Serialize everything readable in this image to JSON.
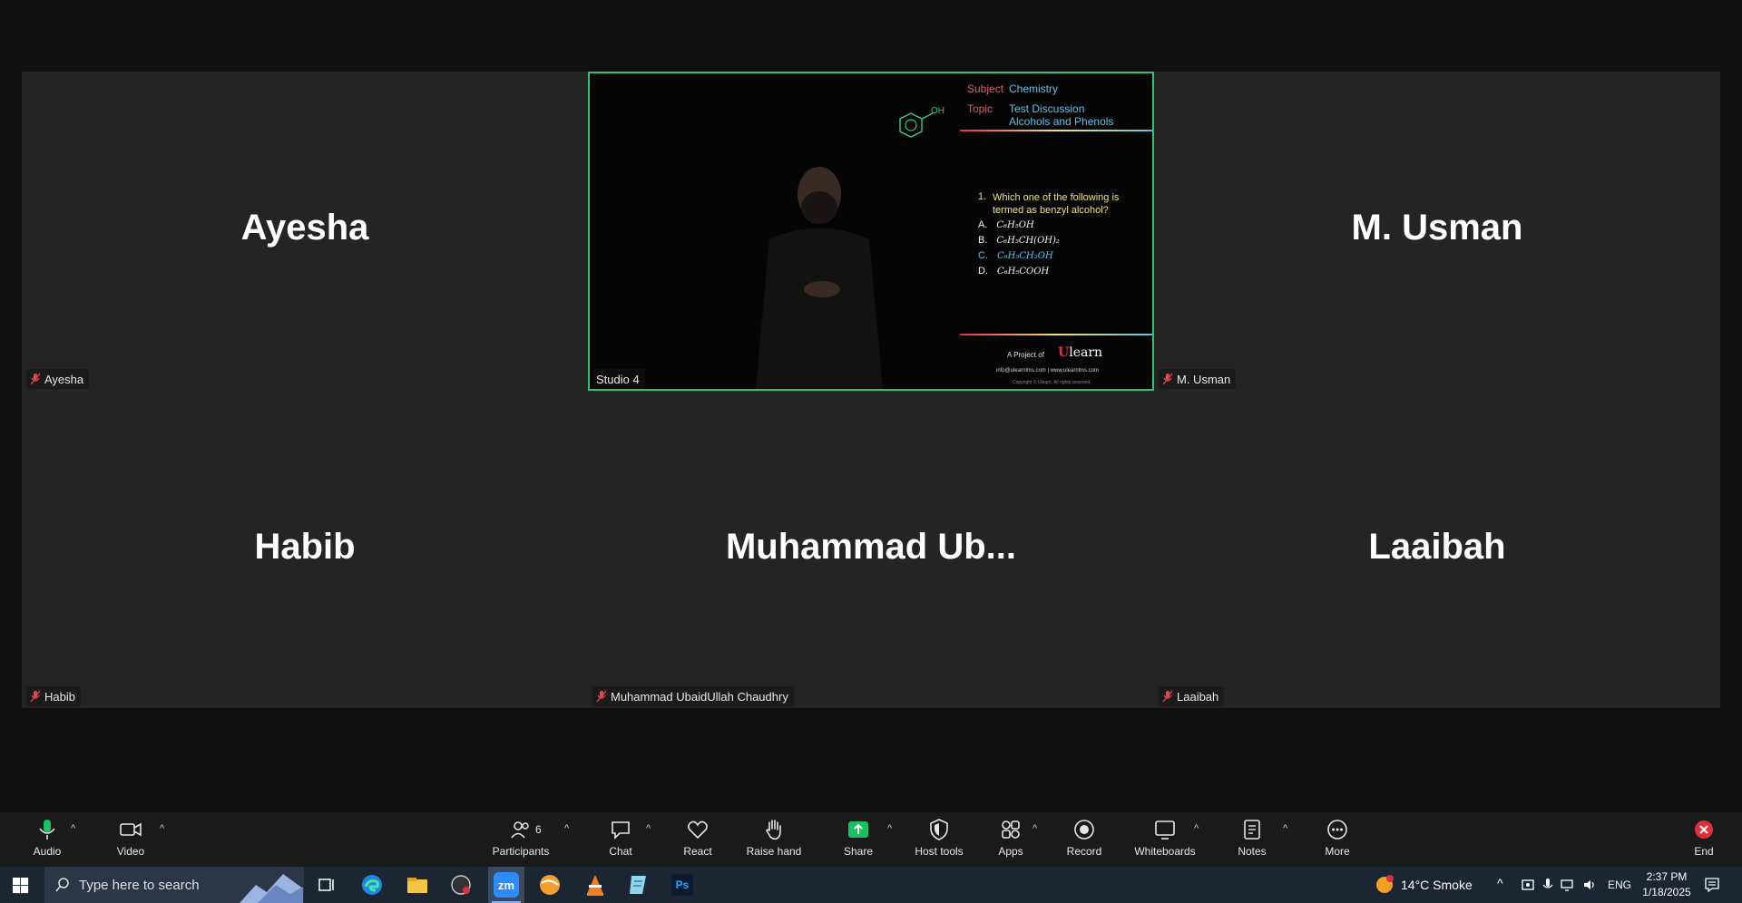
{
  "tiles": {
    "ayesha": {
      "big": "Ayesha",
      "label": "Ayesha"
    },
    "studio": {
      "label": "Studio 4"
    },
    "usman": {
      "big": "M. Usman",
      "label": "M. Usman"
    },
    "habib": {
      "big": "Habib",
      "label": "Habib"
    },
    "muhammad": {
      "big": "Muhammad  Ub...",
      "label": "Muhammad UbaidUllah Chaudhry"
    },
    "laaibah": {
      "big": "Laaibah",
      "label": "Laaibah"
    }
  },
  "slide": {
    "subject_label": "Subject",
    "subject_value": "Chemistry",
    "topic_label": "Topic",
    "topic_line1": "Test Discussion",
    "topic_line2": "Alcohols and Phenols",
    "molecule_label": "OH",
    "question_num": "1.",
    "question": "Which one of the following is termed as benzyl alcohol?",
    "options": [
      {
        "letter": "A.",
        "formula": "C₆H₅OH"
      },
      {
        "letter": "B.",
        "formula": "C₆H₅CH(OH)₂"
      },
      {
        "letter": "C.",
        "formula": "C₆H₅CH₂OH"
      },
      {
        "letter": "D.",
        "formula": "C₆H₅COOH"
      }
    ],
    "footer_prefix": "A Project of",
    "footer_brand": "learn",
    "footer_web": "info@ulearnlms.com | www.ulearnlms.com",
    "footer_copy": "Copyright © Ulearn. All rights reserved."
  },
  "toolbar": {
    "audio": "Audio",
    "video": "Video",
    "participants": "Participants",
    "participants_count": "6",
    "chat": "Chat",
    "react": "React",
    "raise_hand": "Raise hand",
    "share": "Share",
    "host_tools": "Host tools",
    "apps": "Apps",
    "record": "Record",
    "whiteboards": "Whiteboards",
    "notes": "Notes",
    "more": "More",
    "end": "End"
  },
  "taskbar": {
    "search_placeholder": "Type here to search",
    "weather": "14°C  Smoke",
    "lang": "ENG",
    "time": "2:37 PM",
    "date": "1/18/2025"
  },
  "colors": {
    "active_border": "#2ec27e",
    "share_green": "#19c163",
    "end_red": "#e02f3a",
    "mute_red": "#e8474f"
  }
}
